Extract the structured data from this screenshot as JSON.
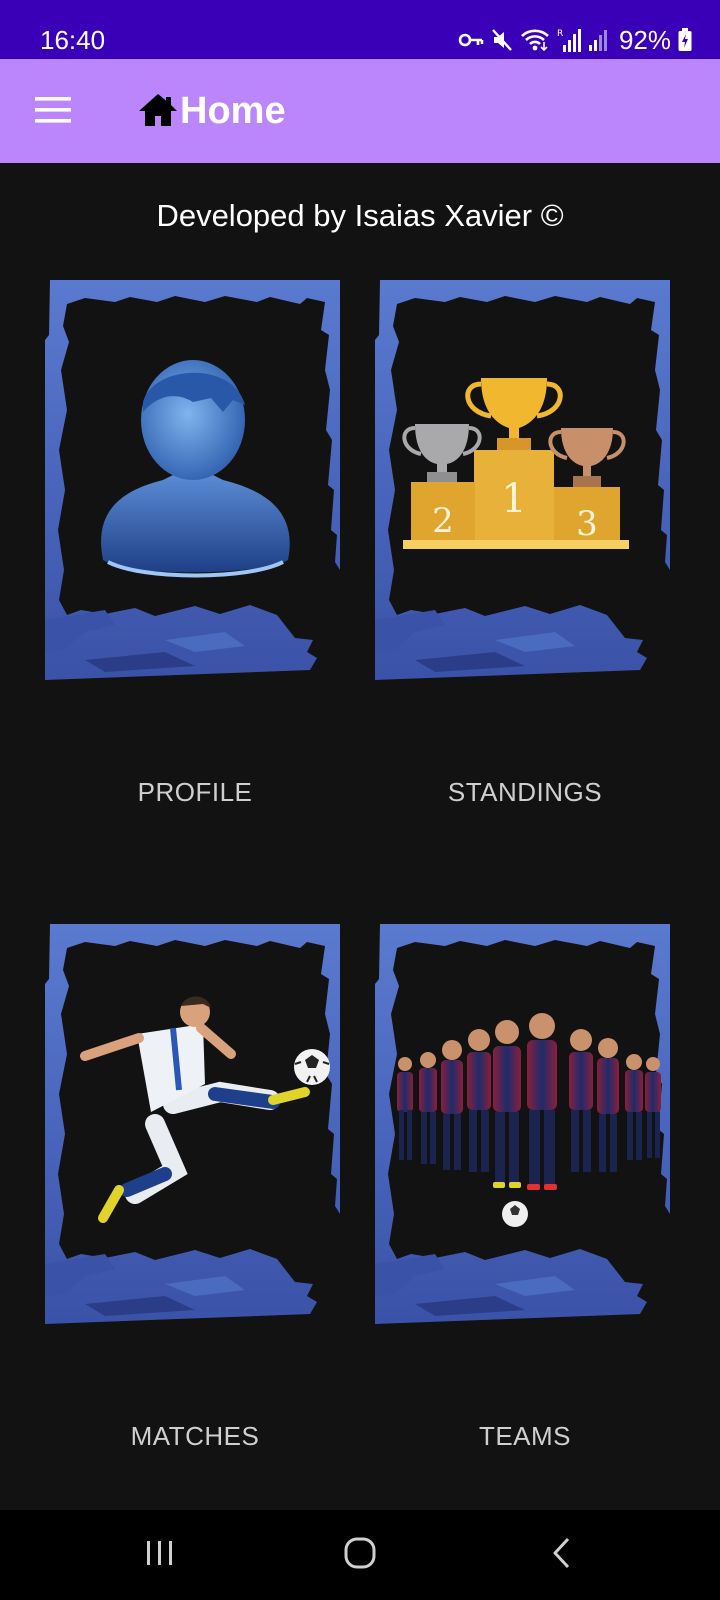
{
  "status_bar": {
    "time": "16:40",
    "battery": "92%",
    "icons": [
      "key-icon",
      "mute-icon",
      "wifi-icon",
      "signal-icon",
      "signal-icon",
      "battery-charging-icon"
    ]
  },
  "app_bar": {
    "title": "Home",
    "menu_icon": "menu-icon",
    "title_icon": "home-icon",
    "background": "#bb86fc"
  },
  "credit_text": "Developed by Isaias Xavier ©",
  "tiles": [
    {
      "label": "PROFILE",
      "image": "profile-avatar"
    },
    {
      "label": "STANDINGS",
      "image": "trophy-podium"
    },
    {
      "label": "MATCHES",
      "image": "soccer-player-kick"
    },
    {
      "label": "TEAMS",
      "image": "team-photo"
    }
  ],
  "nav_bar": {
    "buttons": [
      "recent-apps-icon",
      "home-circle-icon",
      "back-icon"
    ]
  },
  "colors": {
    "status_bar": "#3a00b8",
    "background": "#121212",
    "frame_blue": "#4a6bc0",
    "label_text": "#cfcfcf"
  }
}
